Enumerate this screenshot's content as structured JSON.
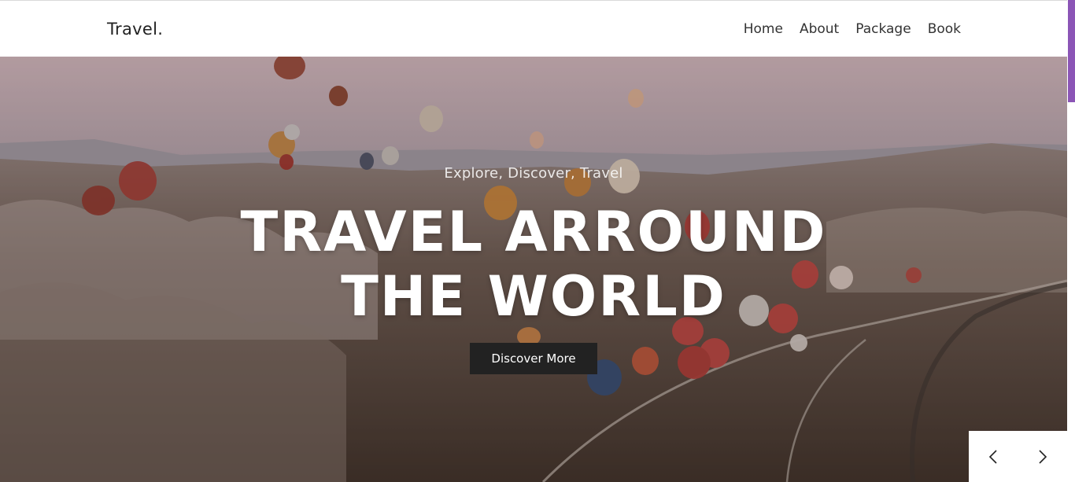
{
  "header": {
    "logo": "Travel.",
    "nav": [
      "Home",
      "About",
      "Package",
      "Book"
    ]
  },
  "hero": {
    "tagline": "Explore, Discover, Travel",
    "title_line1": "TRAVEL ARROUND",
    "title_line2": "THE WORLD",
    "cta_label": "Discover More"
  },
  "slider": {
    "prev_icon": "chevron-left-icon",
    "next_icon": "chevron-right-icon"
  },
  "colors": {
    "accent": "#8b55b6",
    "button_bg": "#222222",
    "header_bg": "#ffffff"
  }
}
